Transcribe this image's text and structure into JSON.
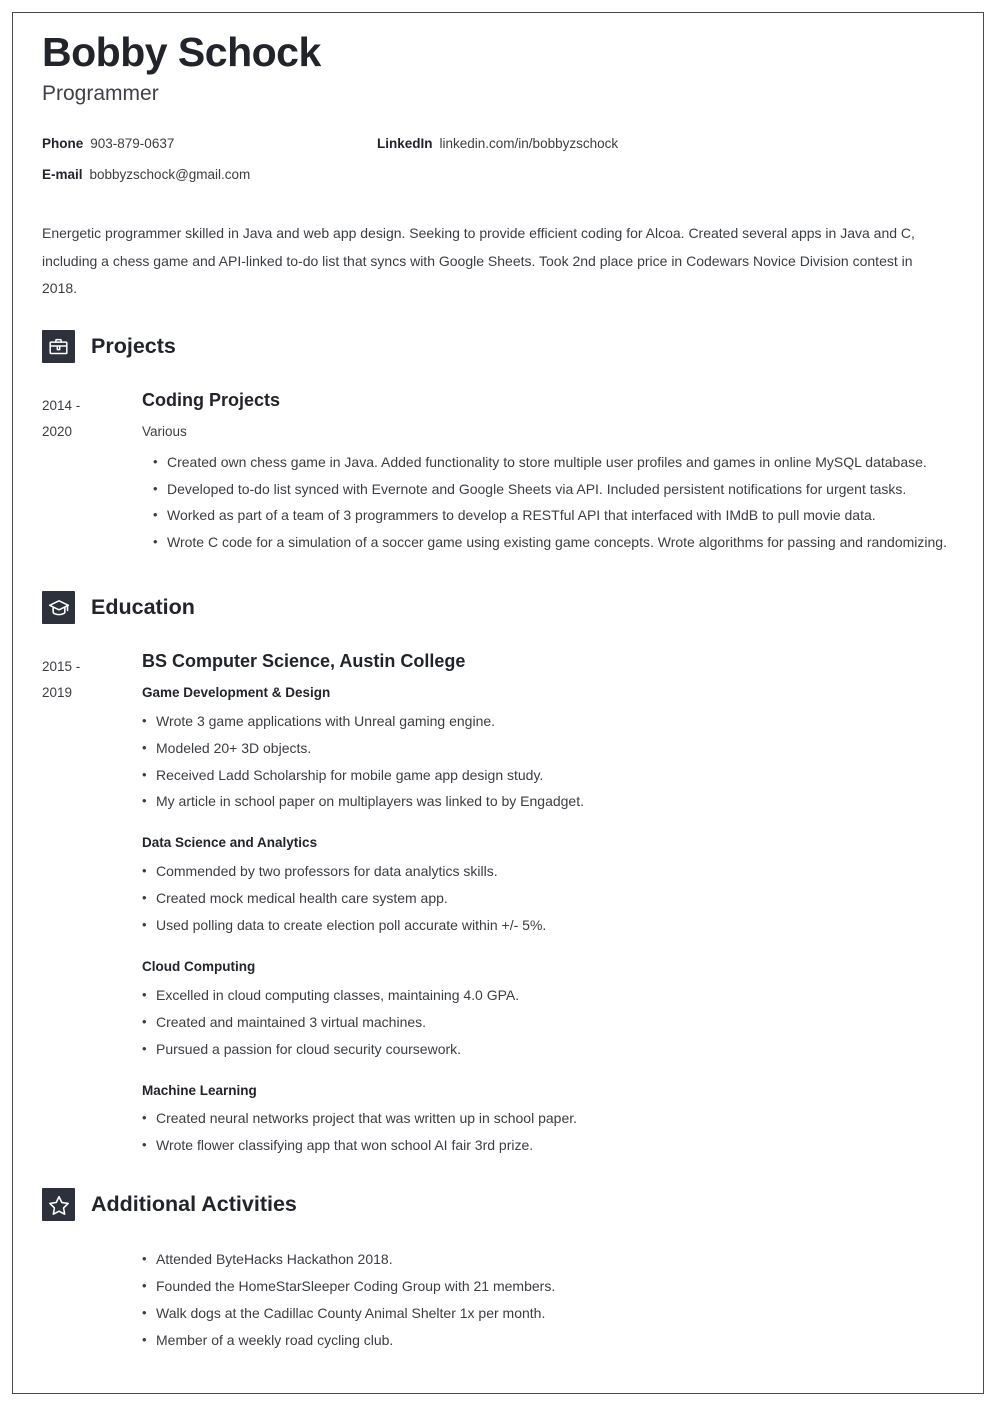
{
  "header": {
    "name": "Bobby Schock",
    "job_title": "Programmer",
    "contacts": [
      {
        "label": "Phone",
        "value": "903-879-0637"
      },
      {
        "label": "LinkedIn",
        "value": "linkedin.com/in/bobbyzschock"
      },
      {
        "label": "E-mail",
        "value": "bobbyzschock@gmail.com"
      }
    ]
  },
  "summary": "Energetic programmer skilled in Java and web app design. Seeking to provide efficient coding for Alcoa. Created several apps in Java and C, including a chess game and API-linked to-do list that syncs with Google Sheets. Took 2nd place price in Codewars Novice Division contest in 2018.",
  "sections": {
    "projects": {
      "title": "Projects",
      "icon": "briefcase-icon",
      "entry": {
        "date_start": "2014 -",
        "date_end": "2020",
        "title": "Coding Projects",
        "subtitle": "Various",
        "bullets": [
          "Created own chess game in Java. Added functionality to store multiple user profiles and games in online MySQL database.",
          "Developed to-do list synced with Evernote and Google Sheets via API. Included persistent notifications for urgent tasks.",
          "Worked as part of a team of 3 programmers to develop a RESTful API that interfaced with IMdB to pull movie data.",
          "Wrote C code for a simulation of a soccer game using existing game concepts. Wrote algorithms for passing and randomizing."
        ]
      }
    },
    "education": {
      "title": "Education",
      "icon": "graduation-cap-icon",
      "entry": {
        "date_start": "2015 -",
        "date_end": "2019",
        "title": "BS Computer Science, Austin College",
        "blocks": [
          {
            "heading": "Game Development & Design",
            "bullets": [
              "Wrote 3 game applications with Unreal gaming engine.",
              "Modeled 20+ 3D objects.",
              "Received Ladd Scholarship for mobile game app design study.",
              "My article in school paper on multiplayers was linked to by Engadget."
            ]
          },
          {
            "heading": "Data Science and Analytics",
            "bullets": [
              "Commended by two professors for data analytics skills.",
              "Created mock medical health care system app.",
              "Used polling data to create election poll accurate within +/- 5%."
            ]
          },
          {
            "heading": "Cloud Computing",
            "bullets": [
              "Excelled in cloud computing classes, maintaining 4.0 GPA.",
              "Created and maintained 3 virtual machines.",
              "Pursued a passion for cloud security coursework."
            ]
          },
          {
            "heading": "Machine Learning",
            "bullets": [
              "Created neural networks project that was written up in school paper.",
              "Wrote flower classifying app that won school AI fair 3rd prize."
            ]
          }
        ]
      }
    },
    "activities": {
      "title": "Additional Activities",
      "icon": "star-icon",
      "bullets": [
        "Attended ByteHacks Hackathon 2018.",
        "Founded the HomeStarSleeper Coding Group with 21 members.",
        "Walk dogs at the Cadillac County Animal Shelter 1x per month.",
        "Member of a weekly road cycling club."
      ]
    }
  },
  "colors": {
    "icon_background": "#2d313c",
    "heading_text": "#22242b",
    "body_text": "#3a3d42",
    "page_border": "#4a4a4a"
  }
}
